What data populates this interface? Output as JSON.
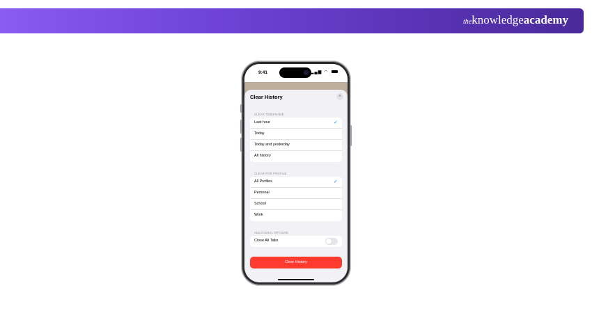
{
  "brand": {
    "prefix": "the",
    "name": "knowledge",
    "suffix": "academy"
  },
  "status_bar": {
    "time": "9:41",
    "icons": "signal-icon wifi-icon battery-icon"
  },
  "sheet": {
    "title": "Clear History",
    "close_icon": "×",
    "timeframe": {
      "header": "CLEAR TIMEFRAME",
      "items": [
        {
          "label": "Last hour",
          "selected": true
        },
        {
          "label": "Today",
          "selected": false
        },
        {
          "label": "Today and yesterday",
          "selected": false
        },
        {
          "label": "All history",
          "selected": false
        }
      ]
    },
    "profile": {
      "header": "CLEAR FOR PROFILE",
      "items": [
        {
          "label": "All Profiles",
          "selected": true
        },
        {
          "label": "Personal",
          "selected": false
        },
        {
          "label": "School",
          "selected": false
        },
        {
          "label": "Work",
          "selected": false
        }
      ]
    },
    "additional": {
      "header": "ADDITIONAL OPTIONS",
      "close_all_tabs": {
        "label": "Close All Tabs",
        "on": false
      }
    },
    "clear_button": "Clear History"
  },
  "colors": {
    "banner_start": "#8a5cf0",
    "banner_end": "#4a2a9a",
    "accent": "#0a84ff",
    "destructive": "#ff3b30"
  }
}
